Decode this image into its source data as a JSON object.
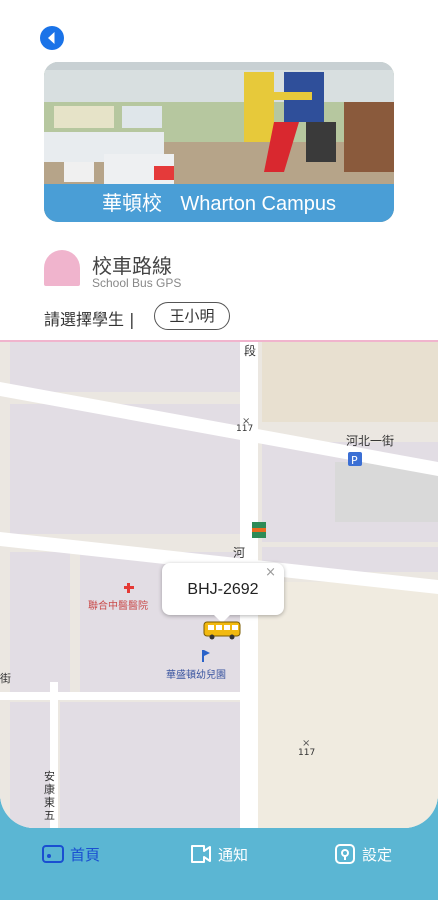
{
  "header": {
    "back_icon": "back-arrow-icon",
    "hero_school": "華頓校",
    "hero_campus": "Wharton Campus"
  },
  "route": {
    "title": "校車路線",
    "subtitle": "School Bus GPS",
    "select_label": "請選擇學生 |",
    "student": "王小明"
  },
  "map": {
    "labels": {
      "road_duan": "段",
      "road_117a": "117",
      "road_hebei": "河北一街",
      "road_he": "河",
      "clinic": "聯合中醫醫院",
      "kindergarten": "華盛頓幼兒園",
      "road_117b": "117",
      "road_anbang": "安康東五",
      "road_di": "街"
    },
    "popup": {
      "plate": "BHJ-2692",
      "close": "×"
    }
  },
  "tabs": [
    {
      "label": "首頁",
      "icon": "home-tab-icon",
      "active": true
    },
    {
      "label": "通知",
      "icon": "notification-icon",
      "active": false
    },
    {
      "label": "設定",
      "icon": "settings-icon",
      "active": false
    }
  ],
  "colors": {
    "accent": "#1a73e8",
    "tabbar": "#5bb6d3",
    "pink": "#f0b4cd",
    "caption": "#4a9ed6"
  }
}
